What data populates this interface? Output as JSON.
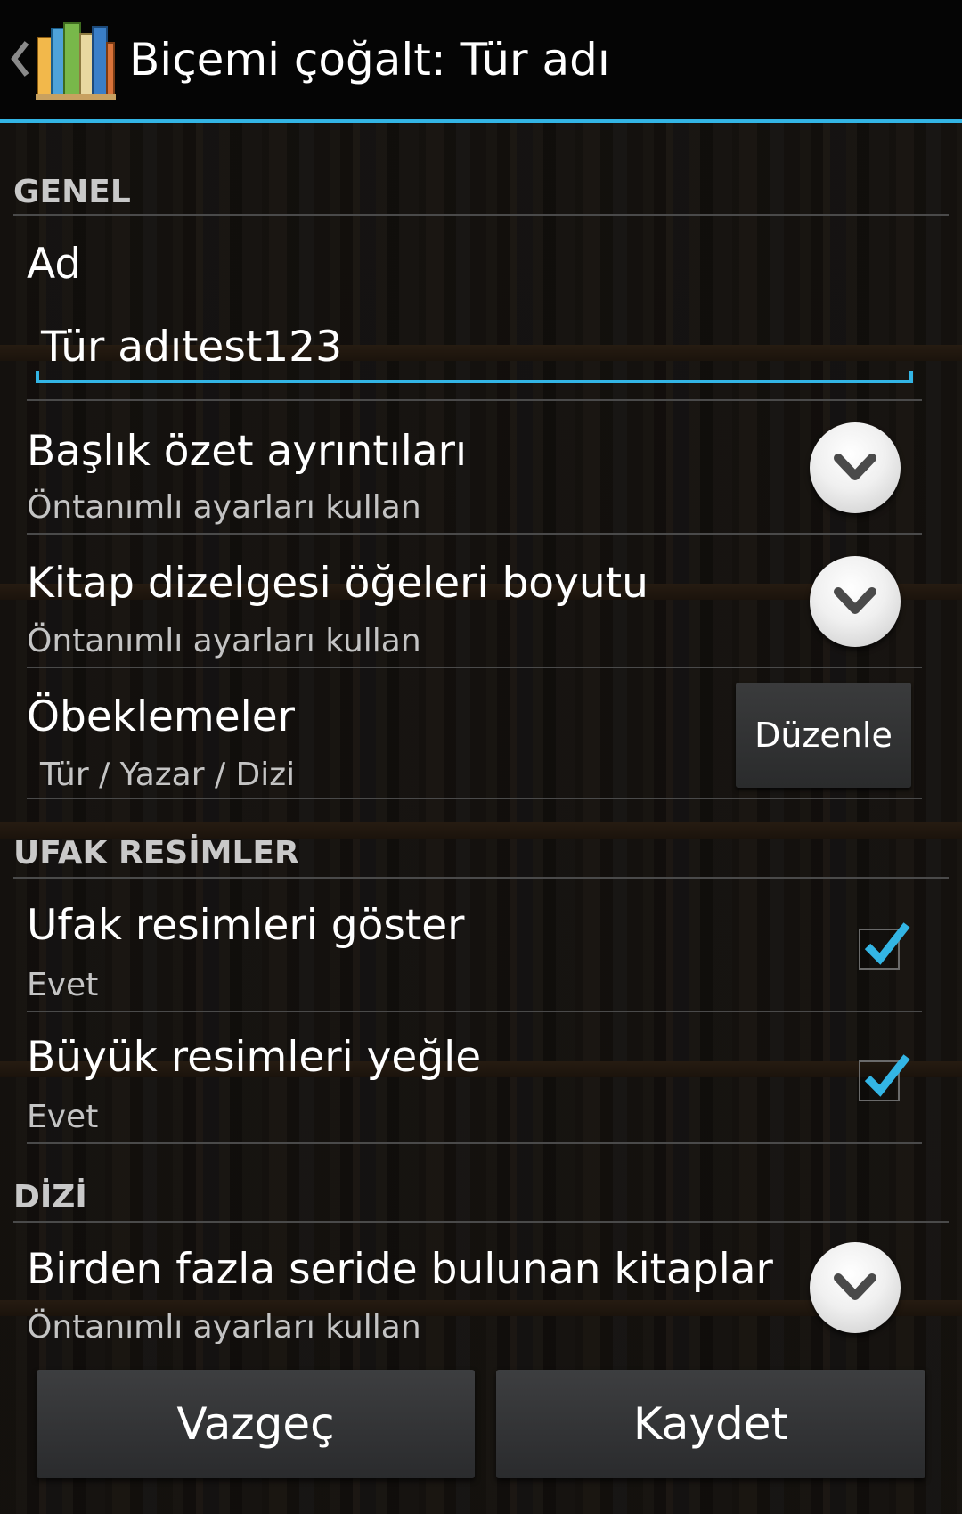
{
  "action_bar": {
    "title": "Biçemi çoğalt: Tür adı",
    "back_icon": "back-chevron-icon",
    "app_icon": "book-shelf-app-icon",
    "accent_color": "#33b5e5"
  },
  "sections": {
    "general": "GENEL",
    "thumbnails": "UFAK RESİMLER",
    "series": "DİZİ"
  },
  "name_field": {
    "label": "Ad",
    "value": "Tür adıtest123"
  },
  "prefs": {
    "header_details": {
      "title": "Başlık özet ayrıntıları",
      "summary": "Öntanımlı ayarları kullan"
    },
    "book_list_item_size": {
      "title": "Kitap dizelgesi öğeleri boyutu",
      "summary": "Öntanımlı ayarları kullan"
    },
    "groupings": {
      "title": "Öbeklemeler",
      "summary": "Tür / Yazar / Dizi",
      "button": "Düzenle"
    },
    "show_thumbnails": {
      "title": "Ufak resimleri göster",
      "summary": "Evet",
      "checked": true
    },
    "prefer_large_images": {
      "title": "Büyük resimleri yeğle",
      "summary": "Evet",
      "checked": true
    },
    "books_in_multiple_series": {
      "title": "Birden fazla seride bulunan kitaplar",
      "summary": "Öntanımlı ayarları kullan"
    }
  },
  "buttons": {
    "cancel": "Vazgeç",
    "save": "Kaydet"
  }
}
